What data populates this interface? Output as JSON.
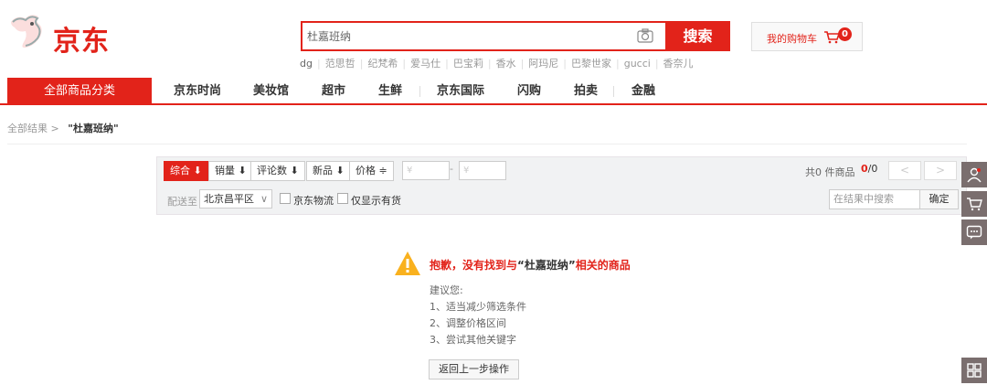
{
  "header": {
    "brand": "京东",
    "search": {
      "value": "杜嘉班纳",
      "button": "搜索"
    },
    "hotwords": [
      "dg",
      "范思哲",
      "纪梵希",
      "爱马仕",
      "巴宝莉",
      "香水",
      "阿玛尼",
      "巴黎世家",
      "gucci",
      "香奈儿"
    ],
    "cart": {
      "label": "我的购物车",
      "count": "0"
    }
  },
  "nav": {
    "all": "全部商品分类",
    "items": [
      "京东时尚",
      "美妆馆",
      "超市",
      "生鲜",
      "京东国际",
      "闪购",
      "拍卖",
      "金融"
    ]
  },
  "breadcrumb": {
    "root": "全部结果",
    "sep": ">",
    "current": "\"杜嘉班纳\""
  },
  "filter": {
    "sorts": [
      "综合 ⬇",
      "销量 ⬇",
      "评论数 ⬇",
      "新品 ⬇",
      "价格 ≑"
    ],
    "price_from_placeholder": "¥",
    "price_to_placeholder": "¥",
    "price_dash": "-",
    "count_text": "共0 件商品",
    "page_current": "0",
    "page_total": "/0",
    "pager_prev": "<",
    "pager_next": ">",
    "deliver_label": "配送至",
    "deliver_area": "北京昌平区",
    "jd_logistics": "京东物流",
    "in_stock_only": "仅显示有货",
    "in_search_placeholder": "在结果中搜索",
    "confirm": "确定"
  },
  "empty": {
    "title_prefix": "抱歉，没有找到与",
    "keyword": "“杜嘉班纳”",
    "title_suffix": "相关的商品",
    "advice": "建议您:",
    "suggestions": [
      "1、适当减少筛选条件",
      "2、调整价格区间",
      "3、尝试其他关键字"
    ],
    "back": "返回上一步操作"
  },
  "colors": {
    "accent": "#e2231a",
    "toolbar": "#7a6e6e"
  },
  "right_toolbar": [
    "user-icon",
    "cart-icon",
    "chat-icon",
    "qr-icon"
  ]
}
